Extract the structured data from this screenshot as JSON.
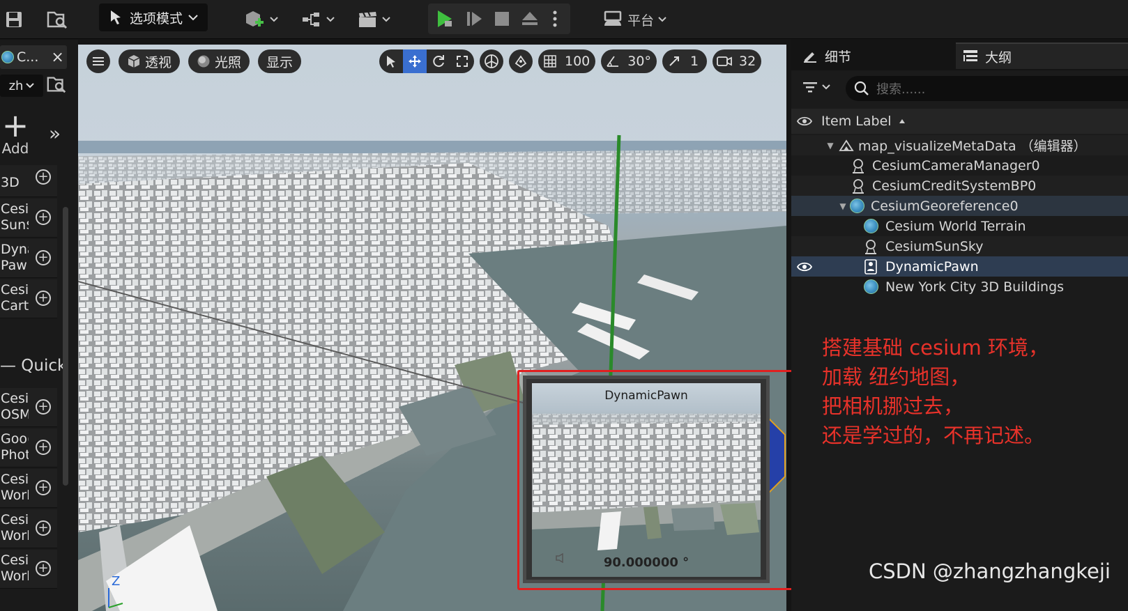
{
  "toolbar": {
    "mode_label": "选项模式",
    "platform_label": "平台"
  },
  "left_panel": {
    "tab_title": "C...",
    "tab_close": "×",
    "lang_value": "zh",
    "add_label": "Add",
    "expand_glyph": "»",
    "items": [
      {
        "line1": "",
        "line2": "3D"
      },
      {
        "line1": "Cesi",
        "line2": "Sun$"
      },
      {
        "line1": "Dyna",
        "line2": "Paw"
      },
      {
        "line1": "Cesi",
        "line2": "Cart"
      }
    ],
    "quick_label": "— Quick",
    "quick_items": [
      {
        "line1": "Cesi",
        "line2": "OSM"
      },
      {
        "line1": "Goo(",
        "line2": "Phot"
      },
      {
        "line1": "Cesi",
        "line2": "Worl"
      },
      {
        "line1": "Cesi",
        "line2": "Worl"
      },
      {
        "line1": "Cesi",
        "line2": "Worl"
      }
    ]
  },
  "viewport": {
    "perspective_label": "透视",
    "lighting_label": "光照",
    "show_label": "显示",
    "grid_value": "100",
    "angle_value": "30°",
    "scale_value": "1",
    "camera_speed": "32",
    "pip_title": "DynamicPawn",
    "pip_angle": "90.000000 °",
    "axis_label": "Z"
  },
  "right_panel": {
    "tab_details": "细节",
    "tab_outliner": "大纲",
    "search_placeholder": "搜索......",
    "column_header": "Item Label",
    "tree": [
      {
        "label": "map_visualizeMetaData （编辑器）"
      },
      {
        "label": "CesiumCameraManager0"
      },
      {
        "label": "CesiumCreditSystemBP0"
      },
      {
        "label": "CesiumGeoreference0"
      },
      {
        "label": "Cesium World Terrain"
      },
      {
        "label": "CesiumSunSky"
      },
      {
        "label": "DynamicPawn"
      },
      {
        "label": "New York City 3D Buildings"
      }
    ]
  },
  "annotation": {
    "line1": "搭建基础 cesium 环境，",
    "line2": "加载 纽约地图，",
    "line3": "把相机挪过去，",
    "line4": "还是学过的，不再记述。"
  },
  "watermark": "CSDN @zhangzhangkeji",
  "colors": {
    "annotation_red": "#e8322a",
    "selection_blue": "#2e3d52",
    "play_green": "#3fbf3f",
    "active_tool_blue": "#3a6fd0"
  }
}
